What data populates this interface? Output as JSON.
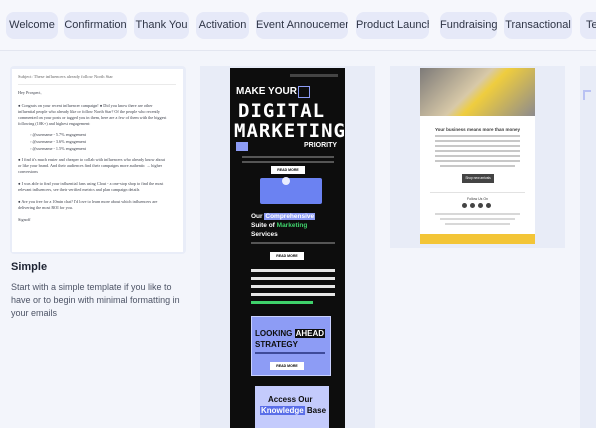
{
  "tabs": [
    "Welcome",
    "Confirmation",
    "Thank You",
    "Activation",
    "Event Annoucement",
    "Product Launch",
    "Fundraising",
    "Transactional",
    "Te"
  ],
  "simple_preview": {
    "subject": "Subject: These influencers already follow North Star",
    "lines": [
      "Hey Prospect,",
      "● Congrats on your recent influencer campaign! ● Did you know there are other",
      "influential people who already like or follow North Star? Of the people who recently",
      "commented on your posts or tagged you in them, here are a few of them with the biggest",
      "following (10K+) and highest engagement:",
      "◦ @username - 5.7% engagement",
      "◦ @username - 3.6% engagement",
      "◦ @username - 1.5% engagement",
      "● I find it's much easier and cheaper to collab with influencers who already know about",
      "or like your brand. And their audiences find their campaigns more authentic → higher",
      "conversions",
      "● I was able to find your influential fans using Clout - a one-stop shop to find the most",
      "relevant influencers, see their verified metrics and plan campaign details",
      "● Are you free for a 10min chat? I'd love to learn more about which influencers are",
      "delivering the most ROI for you.",
      "Signoff"
    ]
  },
  "simple_card": {
    "title": "Simple",
    "description_lines": [
      "Start with a simple template if you like to",
      "have or to begin with minimal formatting in",
      "your emails"
    ]
  },
  "digital_preview": {
    "make_your": "MAKE YOUR",
    "headline_1": "DIGITAL",
    "headline_2": "MARKETING",
    "priority": "PRIORITY",
    "read_more_1": "READ MORE",
    "our": "Our",
    "comprehensive": "Comprehensive",
    "suite_of": "Suite of",
    "marketing": "Marketing",
    "services": "Services",
    "read_more_2": "READ MORE",
    "looking": "LOOKING",
    "ahead": "AHEAD",
    "strategy": "STRATEGY",
    "read_more_3": "READ MORE",
    "access_our": "Access Our",
    "knowledge": "Knowledge",
    "base": "Base"
  },
  "fashion_preview": {
    "headline": "Your business means more than money",
    "button": "Shop new arrivals",
    "follow": "Follow Us On"
  },
  "colors": {
    "tab_bg": "#e6e9f8",
    "page_bg": "#f3f5fb",
    "accent_green": "#3fd16b",
    "accent_blue": "#8d9cf5",
    "accent_yellow": "#f3c537"
  }
}
